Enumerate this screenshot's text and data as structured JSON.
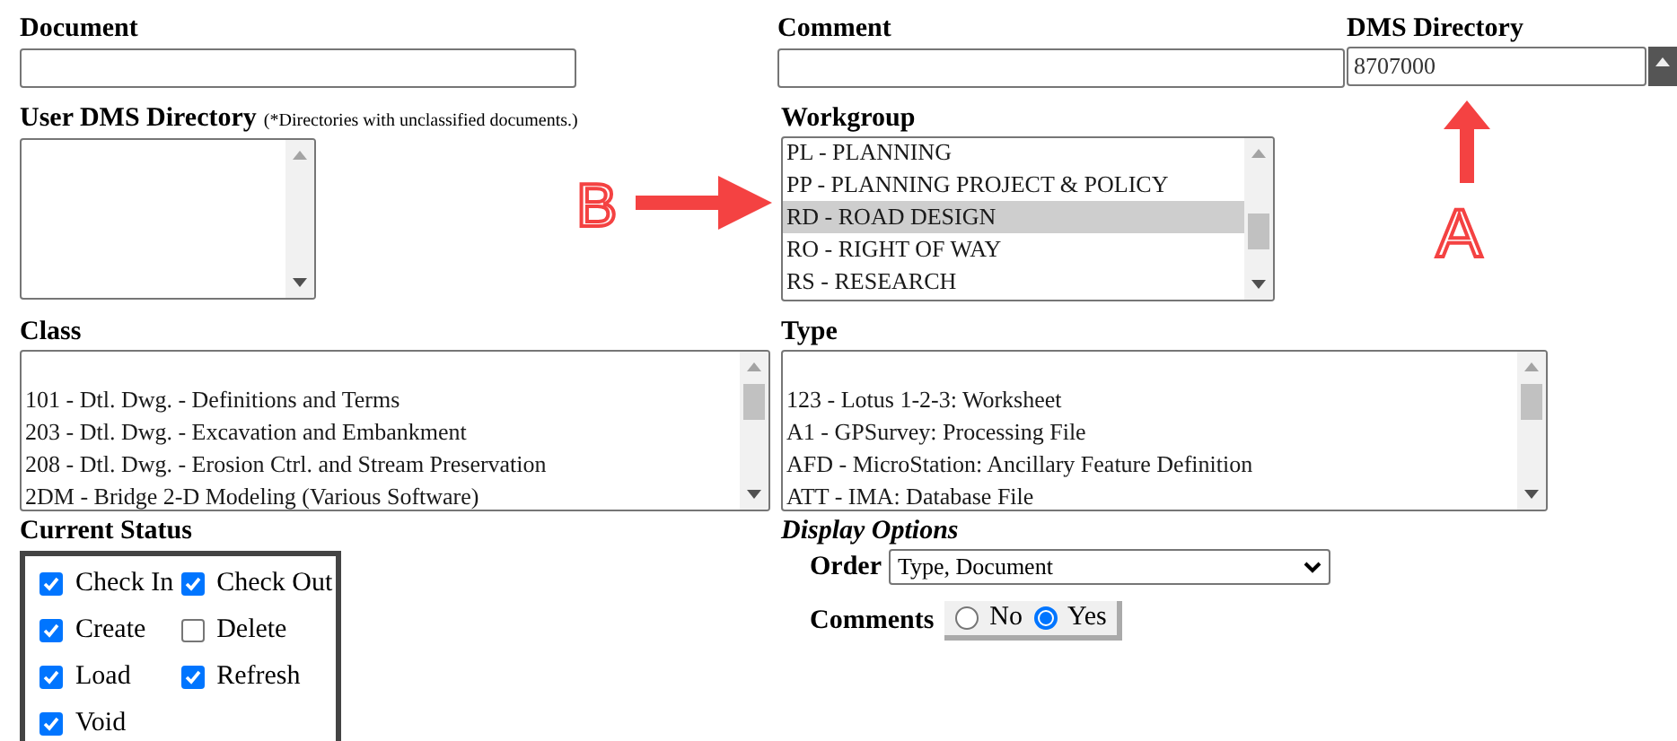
{
  "document": {
    "label": "Document"
  },
  "comment": {
    "label": "Comment"
  },
  "dms_directory": {
    "label": "DMS Directory",
    "value": "8707000"
  },
  "user_dms_directory": {
    "label": "User DMS Directory",
    "note": "(*Directories with unclassified documents.)"
  },
  "workgroup": {
    "label": "Workgroup",
    "options": [
      {
        "text": "PL - PLANNING",
        "selected": false
      },
      {
        "text": "PP - PLANNING PROJECT & POLICY",
        "selected": false
      },
      {
        "text": "RD - ROAD DESIGN",
        "selected": true
      },
      {
        "text": "RO - RIGHT OF WAY",
        "selected": false
      },
      {
        "text": "RS - RESEARCH",
        "selected": false
      }
    ]
  },
  "class": {
    "label": "Class",
    "options": [
      {
        "text": "101 - Dtl. Dwg. - Definitions and Terms",
        "selected": false
      },
      {
        "text": "203 - Dtl. Dwg. - Excavation and Embankment",
        "selected": false
      },
      {
        "text": "208 - Dtl. Dwg. - Erosion Ctrl. and Stream Preservation",
        "selected": false
      },
      {
        "text": "2DM - Bridge 2-D Modeling (Various Software)",
        "selected": false
      }
    ]
  },
  "type": {
    "label": "Type",
    "options": [
      {
        "text": "123 - Lotus 1-2-3: Worksheet",
        "selected": false
      },
      {
        "text": "A1 - GPSurvey: Processing File",
        "selected": false
      },
      {
        "text": "AFD - MicroStation: Ancillary Feature Definition",
        "selected": false
      },
      {
        "text": "ATT - IMA: Database File",
        "selected": false
      }
    ]
  },
  "current_status": {
    "label": "Current Status",
    "items": [
      {
        "label": "Check In",
        "checked": true
      },
      {
        "label": "Check Out",
        "checked": true
      },
      {
        "label": "Create",
        "checked": true
      },
      {
        "label": "Delete",
        "checked": false
      },
      {
        "label": "Load",
        "checked": true
      },
      {
        "label": "Refresh",
        "checked": true
      },
      {
        "label": "Void",
        "checked": true
      }
    ]
  },
  "display_options": {
    "title": "Display Options",
    "order": {
      "label": "Order",
      "value": "Type, Document"
    },
    "comments": {
      "label": "Comments",
      "options": [
        {
          "label": "No",
          "selected": false
        },
        {
          "label": "Yes",
          "selected": true
        }
      ]
    }
  },
  "annotations": [
    {
      "label": "A"
    },
    {
      "label": "B"
    }
  ]
}
